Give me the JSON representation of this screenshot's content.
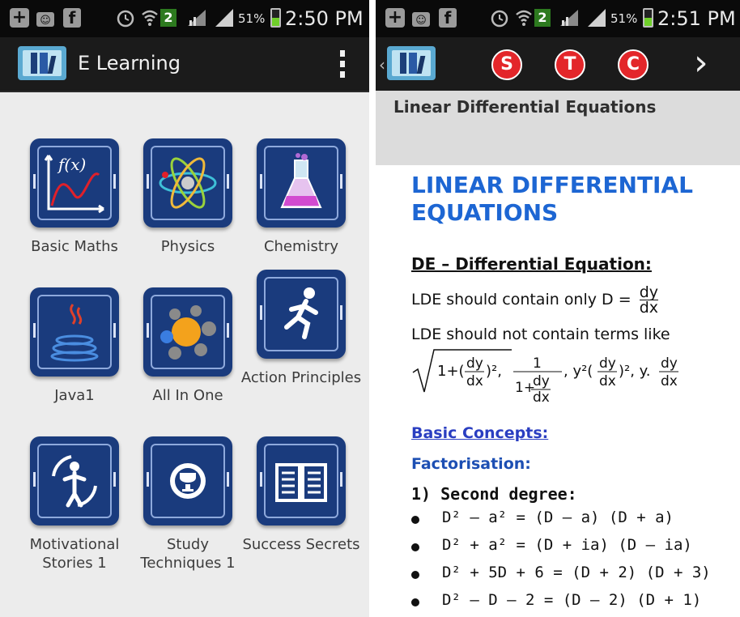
{
  "left": {
    "status": {
      "battery": "51%",
      "time": "2:50 PM",
      "network_badge": "2"
    },
    "app": {
      "title": "E Learning"
    },
    "items": [
      {
        "label": "Basic Maths",
        "icon": "function-graph-icon"
      },
      {
        "label": "Physics",
        "icon": "atom-icon"
      },
      {
        "label": "Chemistry",
        "icon": "flask-icon"
      },
      {
        "label": "Java1",
        "icon": "java-cup-icon"
      },
      {
        "label": "All In One",
        "icon": "circles-cluster-icon"
      },
      {
        "label": "Action Principles",
        "icon": "running-man-icon"
      },
      {
        "label": "Motivational Stories 1",
        "icon": "cycle-person-icon"
      },
      {
        "label": "Study Techniques 1",
        "icon": "trophy-icon"
      },
      {
        "label": "Success Secrets",
        "icon": "open-book-icon"
      }
    ]
  },
  "right": {
    "status": {
      "battery": "51%",
      "time": "2:51 PM",
      "network_badge": "2"
    },
    "toolbar": {
      "btn1": "S",
      "btn2": "T",
      "btn3": "C"
    },
    "subheader": "Linear Differential Equations",
    "doc": {
      "title_line1": "LINEAR DIFFERENTIAL",
      "title_line2": "EQUATIONS",
      "de_heading": "DE – Differential  Equation:",
      "lde_contain_prefix": "LDE should contain only D =",
      "frac_dy": "dy",
      "frac_dx": "dx",
      "lde_not_contain": "LDE should not contain terms like",
      "basic_concepts": "Basic Concepts:",
      "factorisation": "Factorisation:",
      "second_degree": "1) Second degree:",
      "eq1": "D² – a² = (D – a) (D + a)",
      "eq2": "D² + a² = (D + ia) (D – ia)",
      "eq3": "D² + 5D + 6 = (D + 2) (D + 3)",
      "eq4": "D² – D – 2 = (D – 2) (D + 1)"
    }
  },
  "colors": {
    "tile": "#1a3b7d",
    "heading_blue": "#1d66d3",
    "red_button": "#e3262a"
  }
}
